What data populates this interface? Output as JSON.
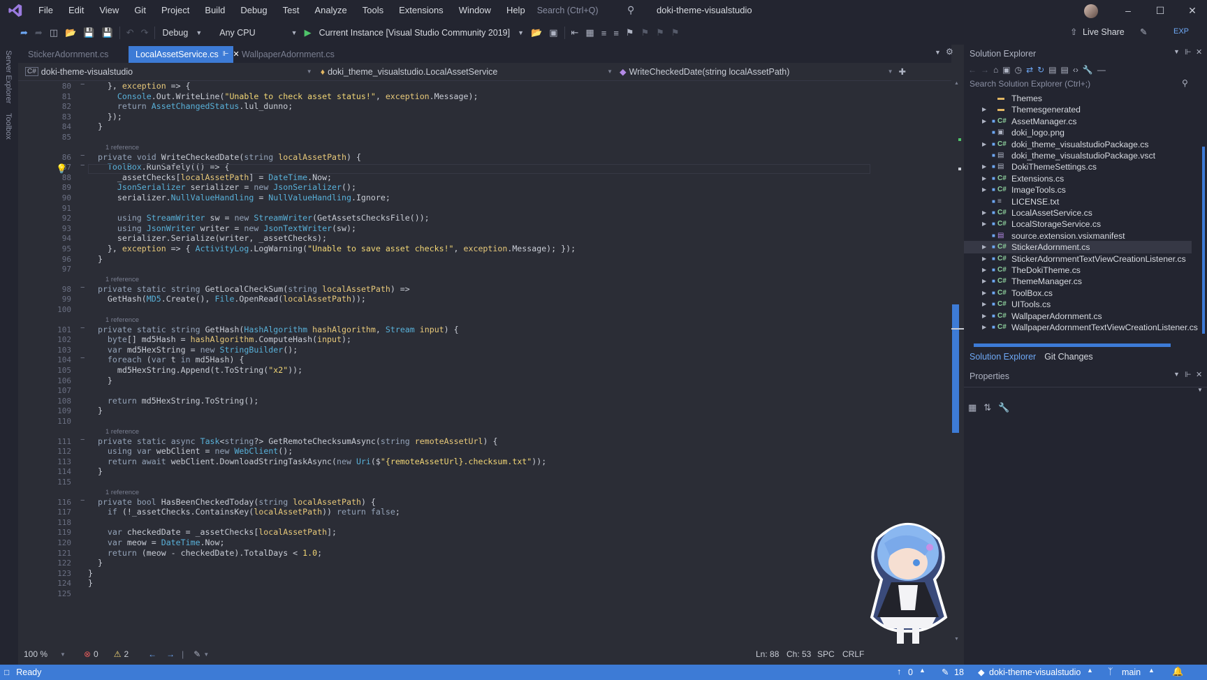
{
  "title_bar": {
    "menus": [
      "File",
      "Edit",
      "View",
      "Git",
      "Project",
      "Build",
      "Debug",
      "Test",
      "Analyze",
      "Tools",
      "Extensions",
      "Window",
      "Help"
    ],
    "search_placeholder": "Search (Ctrl+Q)",
    "solution_name": "doki-theme-visualstudio"
  },
  "toolbar": {
    "config": "Debug",
    "platform": "Any CPU",
    "run_target": "Current Instance [Visual Studio Community 2019]",
    "live_share": "Live Share",
    "exp": "EXP"
  },
  "left_strip": {
    "server_explorer": "Server Explorer",
    "toolbox": "Toolbox"
  },
  "tabs": [
    "StickerAdornment.cs",
    "LocalAssetService.cs",
    "WallpaperAdornment.cs"
  ],
  "active_tab": "LocalAssetService.cs",
  "navbar": {
    "project": "doki-theme-visualstudio",
    "class": "doki_theme_visualstudio.LocalAssetService",
    "member": "WriteCheckedDate(string localAssetPath)"
  },
  "code_lines": [
    {
      "n": "80",
      "t": "    }, exception => {"
    },
    {
      "n": "81",
      "t": "      Console.Out.WriteLine(\"Unable to check asset status!\", exception.Message);"
    },
    {
      "n": "82",
      "t": "      return AssetChangedStatus.lul_dunno;"
    },
    {
      "n": "83",
      "t": "    });"
    },
    {
      "n": "84",
      "t": "  }"
    },
    {
      "n": "85",
      "t": ""
    },
    {
      "n": "86",
      "t": "  private void WriteCheckedDate(string localAssetPath) {",
      "ref": "1 reference"
    },
    {
      "n": "87",
      "t": "    ToolBox.RunSafely(() => {"
    },
    {
      "n": "88",
      "t": "      _assetChecks[localAssetPath] = DateTime.Now;"
    },
    {
      "n": "89",
      "t": "      JsonSerializer serializer = new JsonSerializer();"
    },
    {
      "n": "90",
      "t": "      serializer.NullValueHandling = NullValueHandling.Ignore;"
    },
    {
      "n": "91",
      "t": ""
    },
    {
      "n": "92",
      "t": "      using StreamWriter sw = new StreamWriter(GetAssetsChecksFile());"
    },
    {
      "n": "93",
      "t": "      using JsonWriter writer = new JsonTextWriter(sw);"
    },
    {
      "n": "94",
      "t": "      serializer.Serialize(writer, _assetChecks);"
    },
    {
      "n": "95",
      "t": "    }, exception => { ActivityLog.LogWarning(\"Unable to save asset checks!\", exception.Message); });"
    },
    {
      "n": "96",
      "t": "  }"
    },
    {
      "n": "97",
      "t": ""
    },
    {
      "n": "98",
      "t": "  private static string GetLocalCheckSum(string localAssetPath) =>",
      "ref": "1 reference"
    },
    {
      "n": "99",
      "t": "    GetHash(MD5.Create(), File.OpenRead(localAssetPath));"
    },
    {
      "n": "100",
      "t": ""
    },
    {
      "n": "101",
      "t": "  private static string GetHash(HashAlgorithm hashAlgorithm, Stream input) {",
      "ref": "1 reference"
    },
    {
      "n": "102",
      "t": "    byte[] md5Hash = hashAlgorithm.ComputeHash(input);"
    },
    {
      "n": "103",
      "t": "    var md5HexString = new StringBuilder();"
    },
    {
      "n": "104",
      "t": "    foreach (var t in md5Hash) {"
    },
    {
      "n": "105",
      "t": "      md5HexString.Append(t.ToString(\"x2\"));"
    },
    {
      "n": "106",
      "t": "    }"
    },
    {
      "n": "107",
      "t": ""
    },
    {
      "n": "108",
      "t": "    return md5HexString.ToString();"
    },
    {
      "n": "109",
      "t": "  }"
    },
    {
      "n": "110",
      "t": ""
    },
    {
      "n": "111",
      "t": "  private static async Task<string?> GetRemoteChecksumAsync(string remoteAssetUrl) {",
      "ref": "1 reference"
    },
    {
      "n": "112",
      "t": "    using var webClient = new WebClient();"
    },
    {
      "n": "113",
      "t": "    return await webClient.DownloadStringTaskAsync(new Uri($\"{remoteAssetUrl}.checksum.txt\"));"
    },
    {
      "n": "114",
      "t": "  }"
    },
    {
      "n": "115",
      "t": ""
    },
    {
      "n": "116",
      "t": "  private bool HasBeenCheckedToday(string localAssetPath) {",
      "ref": "1 reference"
    },
    {
      "n": "117",
      "t": "    if (!_assetChecks.ContainsKey(localAssetPath)) return false;"
    },
    {
      "n": "118",
      "t": ""
    },
    {
      "n": "119",
      "t": "    var checkedDate = _assetChecks[localAssetPath];"
    },
    {
      "n": "120",
      "t": "    var meow = DateTime.Now;"
    },
    {
      "n": "121",
      "t": "    return (meow - checkedDate).TotalDays < 1.0;"
    },
    {
      "n": "122",
      "t": "  }"
    },
    {
      "n": "123",
      "t": "}"
    },
    {
      "n": "124",
      "t": "}"
    },
    {
      "n": "125",
      "t": ""
    }
  ],
  "editor_status": {
    "zoom": "100 %",
    "errors": "0",
    "warnings": "2",
    "ln": "Ln: 88",
    "ch": "Ch: 53",
    "spc": "SPC",
    "eol": "CRLF"
  },
  "solution_explorer": {
    "title": "Solution Explorer",
    "search_placeholder": "Search Solution Explorer (Ctrl+;)",
    "items": [
      {
        "label": "Themes",
        "icon": "folder-icon",
        "expand": false
      },
      {
        "label": "Themesgenerated",
        "icon": "folder-icon",
        "expand": true
      },
      {
        "label": "AssetManager.cs",
        "icon": "csharp-file-icon",
        "expand": true
      },
      {
        "label": "doki_logo.png",
        "icon": "image-file-icon",
        "expand": false
      },
      {
        "label": "doki_theme_visualstudioPackage.cs",
        "icon": "csharp-file-icon",
        "expand": true
      },
      {
        "label": "doki_theme_visualstudioPackage.vsct",
        "icon": "file-icon",
        "expand": false
      },
      {
        "label": "DokiThemeSettings.cs",
        "icon": "file-icon",
        "expand": true
      },
      {
        "label": "Extensions.cs",
        "icon": "csharp-file-icon",
        "expand": true
      },
      {
        "label": "ImageTools.cs",
        "icon": "csharp-file-icon",
        "expand": true
      },
      {
        "label": "LICENSE.txt",
        "icon": "text-file-icon",
        "expand": false
      },
      {
        "label": "LocalAssetService.cs",
        "icon": "csharp-file-icon",
        "expand": true
      },
      {
        "label": "LocalStorageService.cs",
        "icon": "csharp-file-icon",
        "expand": true
      },
      {
        "label": "source.extension.vsixmanifest",
        "icon": "manifest-file-icon",
        "expand": false
      },
      {
        "label": "StickerAdornment.cs",
        "icon": "csharp-file-icon",
        "expand": true,
        "selected": true
      },
      {
        "label": "StickerAdornmentTextViewCreationListener.cs",
        "icon": "csharp-file-icon",
        "expand": true
      },
      {
        "label": "TheDokiTheme.cs",
        "icon": "csharp-file-icon",
        "expand": true
      },
      {
        "label": "ThemeManager.cs",
        "icon": "csharp-file-icon",
        "expand": true
      },
      {
        "label": "ToolBox.cs",
        "icon": "csharp-file-icon",
        "expand": true
      },
      {
        "label": "UITools.cs",
        "icon": "csharp-file-icon",
        "expand": true
      },
      {
        "label": "WallpaperAdornment.cs",
        "icon": "csharp-file-icon",
        "expand": true
      },
      {
        "label": "WallpaperAdornmentTextViewCreationListener.cs",
        "icon": "csharp-file-icon",
        "expand": true
      }
    ],
    "bottom_tabs": [
      "Solution Explorer",
      "Git Changes"
    ]
  },
  "properties": {
    "title": "Properties"
  },
  "status_bar": {
    "ready": "Ready",
    "up": "0",
    "edits": "18",
    "repo": "doki-theme-visualstudio",
    "branch": "main"
  },
  "colors": {
    "accent": "#3d7bd6",
    "bg": "#2b2d36",
    "chrome": "#232530",
    "keyword": "#94a3b8",
    "type": "#59b1d9",
    "string": "#f2d675"
  }
}
